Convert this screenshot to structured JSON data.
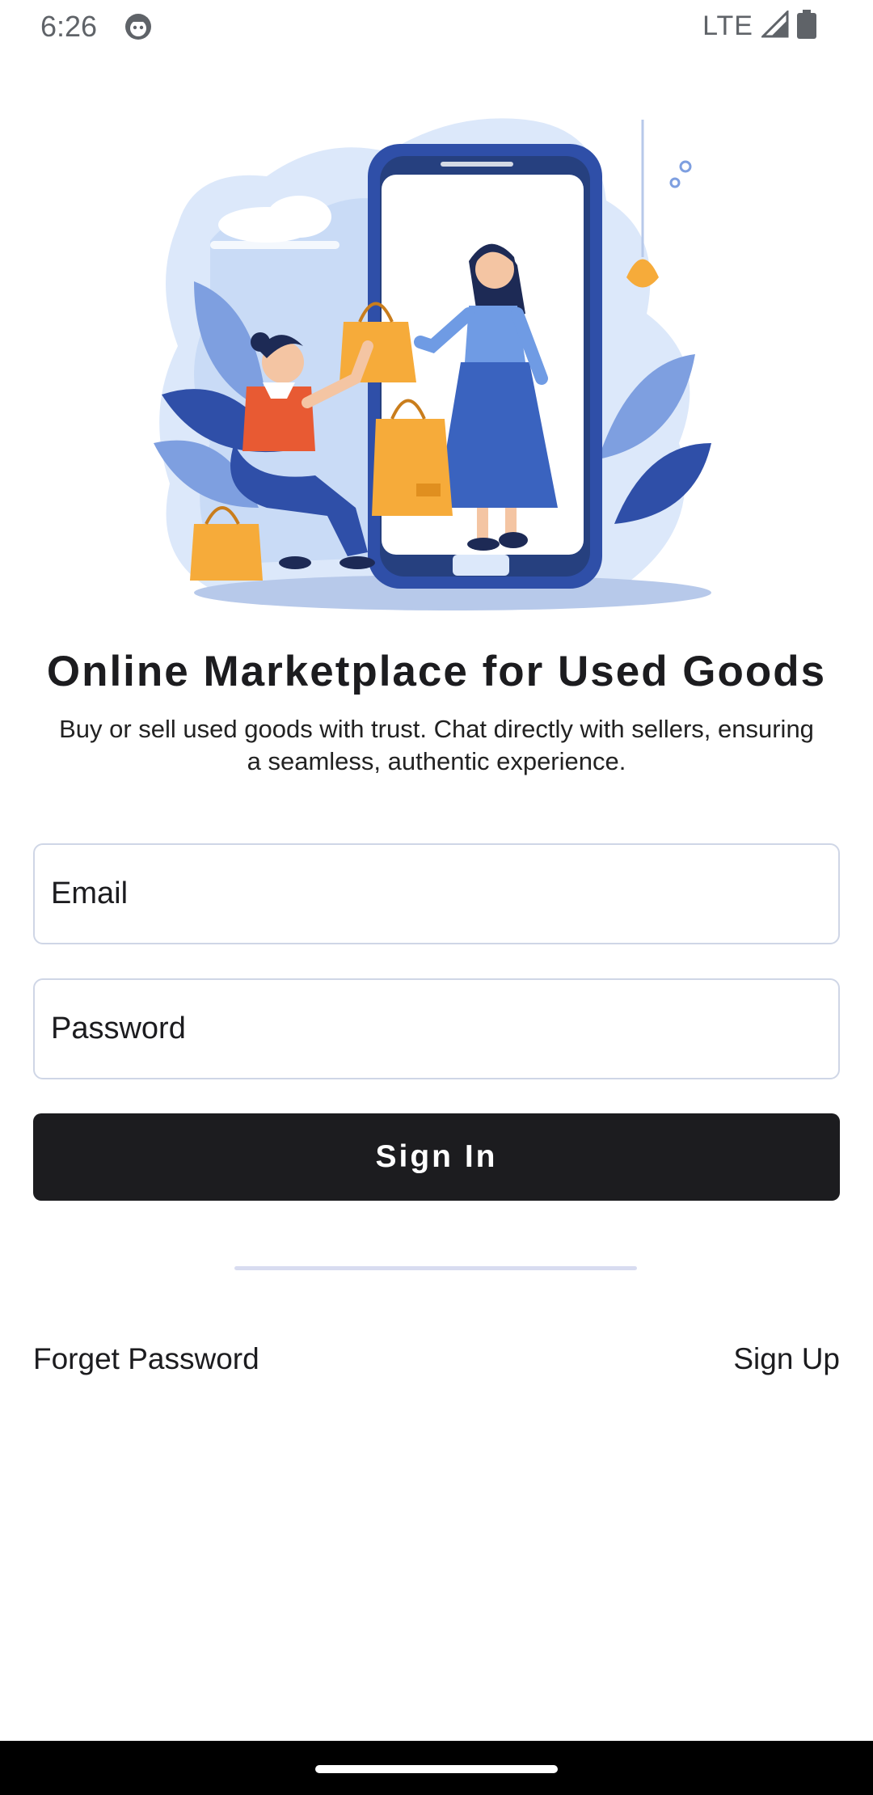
{
  "status_bar": {
    "time": "6:26",
    "network": "LTE",
    "icons": [
      "android-debug-icon",
      "signal-icon",
      "battery-icon"
    ]
  },
  "hero": {
    "icon": "shopping-illustration",
    "colors": {
      "primary": "#2f4fa8",
      "light": "#c9dbf6",
      "accent": "#f6ab3a",
      "shirt": "#e85a33"
    }
  },
  "content": {
    "title": "Online Marketplace for Used Goods",
    "subtitle_line1": "Buy or sell used goods with trust. Chat directly with sellers, ensuring",
    "subtitle_line2": "a seamless, authentic experience."
  },
  "form": {
    "email_placeholder": "Email",
    "password_placeholder": "Password",
    "signin_label": "Sign In"
  },
  "links": {
    "forget_password": "Forget Password",
    "sign_up": "Sign Up"
  },
  "theme": {
    "button_bg": "#1c1c1f",
    "field_border": "#cfd6e6",
    "divider": "#d8dcf0"
  }
}
